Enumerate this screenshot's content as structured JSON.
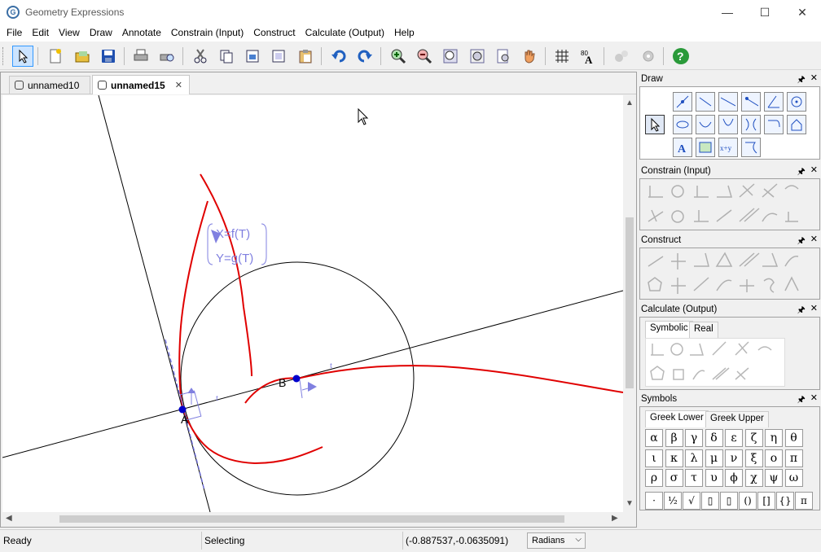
{
  "window": {
    "title": "Geometry Expressions",
    "minimize_glyph": "—",
    "maximize_glyph": "☐",
    "close_glyph": "✕"
  },
  "menu": [
    "File",
    "Edit",
    "View",
    "Draw",
    "Annotate",
    "Constrain (Input)",
    "Construct",
    "Calculate (Output)",
    "Help"
  ],
  "toolbar": {
    "icons": [
      "select-arrow-icon",
      "new-document-icon",
      "open-folder-icon",
      "save-icon",
      "print-icon",
      "print-preview-icon",
      "cut-icon",
      "copy-icon",
      "copy-special-icon",
      "copy-as-icon",
      "paste-icon",
      "undo-icon",
      "redo-icon",
      "zoom-in-icon",
      "zoom-out-icon",
      "zoom-fit-icon",
      "zoom-box-icon",
      "zoom-select-icon",
      "pan-hand-icon",
      "grid-icon",
      "axes-label-icon",
      "animate-icon",
      "settings-icon",
      "help-icon"
    ]
  },
  "tabs": [
    {
      "label": "unnamed10",
      "active": false
    },
    {
      "label": "unnamed15",
      "active": true,
      "close_glyph": "✕"
    }
  ],
  "canvas": {
    "point_a_label": "A",
    "point_b_label": "B",
    "param_eq_x": "X=f(T)",
    "param_eq_y": "Y=g(T)",
    "tick_label": "t",
    "colors": {
      "curve": "#e00000",
      "line": "#000000",
      "tangent": "#7070e0",
      "point": "#0000cc",
      "circle": "#000000"
    }
  },
  "status": {
    "ready": "Ready",
    "mode": "Selecting",
    "coords": "(-0.887537,-0.0635091)",
    "angle_unit": "Radians"
  },
  "panels": {
    "draw": {
      "title": "Draw"
    },
    "constrain": {
      "title": "Constrain (Input)"
    },
    "construct": {
      "title": "Construct"
    },
    "calculate": {
      "title": "Calculate (Output)",
      "tabs": [
        "Symbolic",
        "Real"
      ]
    },
    "symbols": {
      "title": "Symbols",
      "tabs": [
        "Greek Lower",
        "Greek Upper"
      ],
      "rows": [
        [
          "α",
          "β",
          "γ",
          "δ",
          "ε",
          "ζ",
          "η",
          "θ"
        ],
        [
          "ι",
          "κ",
          "λ",
          "μ",
          "ν",
          "ξ",
          "ο",
          "π"
        ],
        [
          "ρ",
          "σ",
          "τ",
          "υ",
          "ϕ",
          "χ",
          "ψ",
          "ω"
        ]
      ],
      "ops": [
        "·",
        "½",
        "√",
        "▯",
        "▯",
        "()",
        "[]",
        "{}",
        "π"
      ]
    },
    "pin_glyph": "🖈",
    "close_glyph": "✕"
  }
}
